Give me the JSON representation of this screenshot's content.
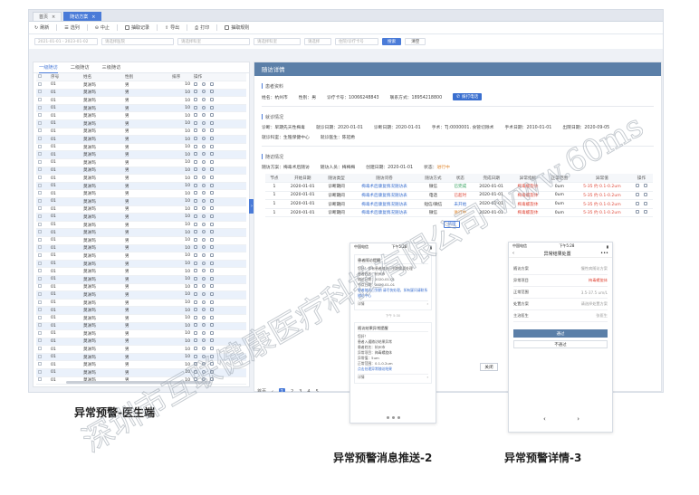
{
  "tabs": [
    {
      "label": "首页"
    },
    {
      "label": "随访方案"
    }
  ],
  "toolbar": {
    "refresh": "刷新",
    "select": "选列",
    "terminate": "中止",
    "extract": "抽取记录",
    "export": "导出",
    "print": "打印",
    "extract_rule": "抽取规则"
  },
  "filters": {
    "date_range": "2021-01-01 - 2023-01-02",
    "plan_placeholder": "请选择医院",
    "dept_placeholder": "请选择科室",
    "staff_placeholder": "请选择科室",
    "mode_placeholder": "请选择",
    "id_placeholder": "住院/诊疗卡号",
    "search_label": "搜索",
    "clear_label": "清空"
  },
  "left": {
    "subtabs": [
      "一级随访",
      "二级随访",
      "三级随访"
    ],
    "columns": [
      "序号",
      "姓名",
      "性别",
      "排序",
      "操作"
    ],
    "rows": [
      {
        "seq": "01",
        "name": "莫洲玛",
        "sex": "男",
        "order": "10"
      },
      {
        "seq": "01",
        "name": "莫洲玛",
        "sex": "男",
        "order": "10"
      },
      {
        "seq": "01",
        "name": "莫洲玛",
        "sex": "男",
        "order": "10"
      },
      {
        "seq": "01",
        "name": "莫洲玛",
        "sex": "男",
        "order": "10"
      },
      {
        "seq": "01",
        "name": "莫洲玛",
        "sex": "男",
        "order": "10"
      },
      {
        "seq": "01",
        "name": "莫洲玛",
        "sex": "男",
        "order": "10"
      },
      {
        "seq": "01",
        "name": "莫洲玛",
        "sex": "男",
        "order": "10"
      },
      {
        "seq": "01",
        "name": "莫洲玛",
        "sex": "男",
        "order": "10"
      },
      {
        "seq": "01",
        "name": "莫洲玛",
        "sex": "男",
        "order": "10"
      },
      {
        "seq": "01",
        "name": "莫洲玛",
        "sex": "男",
        "order": "10"
      },
      {
        "seq": "01",
        "name": "莫洲玛",
        "sex": "男",
        "order": "10"
      },
      {
        "seq": "01",
        "name": "莫洲玛",
        "sex": "男",
        "order": "10"
      },
      {
        "seq": "01",
        "name": "莫洲玛",
        "sex": "男",
        "order": "10"
      },
      {
        "seq": "01",
        "name": "莫洲玛",
        "sex": "男",
        "order": "10"
      },
      {
        "seq": "01",
        "name": "莫洲玛",
        "sex": "男",
        "order": "10"
      },
      {
        "seq": "01",
        "name": "莫洲玛",
        "sex": "男",
        "order": "10"
      },
      {
        "seq": "01",
        "name": "莫洲玛",
        "sex": "男",
        "order": "10"
      },
      {
        "seq": "01",
        "name": "莫洲玛",
        "sex": "男",
        "order": "10"
      },
      {
        "seq": "01",
        "name": "莫洲玛",
        "sex": "男",
        "order": "10"
      },
      {
        "seq": "01",
        "name": "莫洲玛",
        "sex": "男",
        "order": "10"
      },
      {
        "seq": "01",
        "name": "莫洲玛",
        "sex": "男",
        "order": "10"
      },
      {
        "seq": "01",
        "name": "莫洲玛",
        "sex": "男",
        "order": "10"
      },
      {
        "seq": "01",
        "name": "莫洲玛",
        "sex": "男",
        "order": "10"
      },
      {
        "seq": "01",
        "name": "莫洲玛",
        "sex": "男",
        "order": "10"
      },
      {
        "seq": "01",
        "name": "莫洲玛",
        "sex": "男",
        "order": "10"
      },
      {
        "seq": "01",
        "name": "莫洲玛",
        "sex": "男",
        "order": "10"
      },
      {
        "seq": "01",
        "name": "莫洲玛",
        "sex": "男",
        "order": "10"
      },
      {
        "seq": "01",
        "name": "莫洲玛",
        "sex": "男",
        "order": "10"
      },
      {
        "seq": "01",
        "name": "莫洲玛",
        "sex": "男",
        "order": "10"
      },
      {
        "seq": "01",
        "name": "莫洲玛",
        "sex": "男",
        "order": "10"
      },
      {
        "seq": "01",
        "name": "莫洲玛",
        "sex": "男",
        "order": "10"
      },
      {
        "seq": "01",
        "name": "莫洲玛",
        "sex": "男",
        "order": "10"
      },
      {
        "seq": "01",
        "name": "莫洲玛",
        "sex": "男",
        "order": "10"
      },
      {
        "seq": "01",
        "name": "莫洲玛",
        "sex": "男",
        "order": "10"
      },
      {
        "seq": "01",
        "name": "莫洲玛",
        "sex": "男",
        "order": "10"
      },
      {
        "seq": "01",
        "name": "莫洲玛",
        "sex": "男",
        "order": "10"
      },
      {
        "seq": "01",
        "name": "莫洲玛",
        "sex": "男",
        "order": "10"
      },
      {
        "seq": "01",
        "name": "莫洲玛",
        "sex": "男",
        "order": "10"
      },
      {
        "seq": "01",
        "name": "莫洲玛",
        "sex": "男",
        "order": "10"
      }
    ]
  },
  "detail": {
    "title": "随访详情",
    "patient_section": "患者资料",
    "name": "姓名：杭州市",
    "sex": "性别：男",
    "card": "诊疗卡号：10066248843",
    "contact": "联系方式：18954218800",
    "call_label": "拨打电话",
    "visit_section": "就诊情况",
    "diagnosis": "诊断：早期先天性梅毒",
    "visit_date": "就诊日期：2020-01-01",
    "diag_date": "诊断日期：2020-01-01",
    "surgery": "手术：TJ:0000001. 食管切除术",
    "surgery_date": "手术日期：2010-01-01",
    "discharge_date": "出院日期：2020-09-05",
    "dept": "就诊科室：生殖保健中心",
    "doctor": "就诊医生：陈冠希",
    "fu_section": "随访情况",
    "fu_plan": "随访方案：梅毒术后随访",
    "fu_staff": "随访人员：梅梅梅",
    "created": "创建日期：2020-01-01",
    "status": "状态：",
    "status_value": "进行中",
    "fu_columns": [
      "节点",
      "开始日期",
      "随访类型",
      "随访问卷",
      "随访方式",
      "状态",
      "完成日期",
      "异常指标",
      "正常范围",
      "异常值",
      "操作"
    ],
    "fu_rows": [
      {
        "node": "1",
        "start": "2020-01-01",
        "type": "诊断期间",
        "form": "梅毒术后康复情况随访表",
        "mode": "微信",
        "status": "已完成",
        "done": "2020-01-01",
        "abn": "梅毒螺旋体",
        "range": "0um",
        "val": "5-35 约 0.1-0.2um"
      },
      {
        "node": "1",
        "start": "2020-01-01",
        "type": "诊断期间",
        "form": "梅毒术后康复情况随访表",
        "mode": "电话",
        "status": "已超时",
        "done": "2020-01-01",
        "abn": "梅毒螺旋体",
        "range": "0um",
        "val": "5-35 约 0.1-0.2um"
      },
      {
        "node": "1",
        "start": "2020-01-01",
        "type": "诊断期间",
        "form": "梅毒术后康复情况随访表",
        "mode": "短信/微信",
        "status": "未开始",
        "done": "2020-01-01",
        "abn": "梅毒螺旋体",
        "range": "0um",
        "val": "5-35 约 0.1-0.2um"
      },
      {
        "node": "1",
        "start": "2020-01-01",
        "type": "诊断期间",
        "form": "梅毒术后康复情况随访表",
        "mode": "微信",
        "status": "进行中",
        "done": "2020-01-01",
        "abn": "梅毒螺旋体",
        "range": "0um",
        "val": "5-35 约 0.1-0.2um"
      }
    ],
    "add_label": "新增",
    "close_label": "关闭"
  },
  "pager": {
    "first": "首页",
    "pages": [
      "1",
      "2",
      "3",
      "4",
      "5"
    ]
  },
  "phone1": {
    "time": "下午5:28",
    "carrier": "中国电信",
    "card1_title": "患者随访提醒",
    "card1_lines": [
      "您好！你有患者随访已到期需要处理",
      "患者姓名：杭州市",
      "随访日期：2020-01-01",
      "节点日期：2020-01-01"
    ],
    "card1_link": "患者随访已到期 请尽快处理，如有疑问请联系随访中心",
    "card1_footer": "详情",
    "sep_time": "下午 5:30",
    "card2_title": "随访结果异常提醒",
    "card2_lines": [
      "您好！",
      "患者入通随访结果异常",
      "患者姓名：杭州市",
      "异常项目：梅毒螺旋体",
      "异常值：5um",
      "正常范围：0.1-0.2um"
    ],
    "card2_link": "点击处理异常随访结果",
    "card2_footer": "详情"
  },
  "phone2": {
    "time": "下午5:28",
    "carrier": "中国电信",
    "title": "异常结果处置",
    "fields": [
      {
        "k": "随访方案",
        "v": "慢性病随访方案"
      },
      {
        "k": "异常项目",
        "v": "梅毒螺旋体"
      },
      {
        "k": "正常范围",
        "v": "3.5-37.5 um/L"
      },
      {
        "k": "处置方案",
        "v": "请选择处置方案"
      },
      {
        "k": "主治医生",
        "v": "张医生"
      }
    ],
    "pass_label": "通过",
    "fail_label": "不通过"
  },
  "captions": {
    "doctor": "异常预警-医生端",
    "push": "异常预警消息推送-2",
    "detail": "异常预警详情-3"
  },
  "watermark": "深圳市互联健康医疗科技有限公司 www.60ms.net",
  "colors": {
    "accent": "#4a7bd8",
    "header": "#5b7fa8",
    "danger": "#e04b3c",
    "success": "#2a9d57"
  }
}
